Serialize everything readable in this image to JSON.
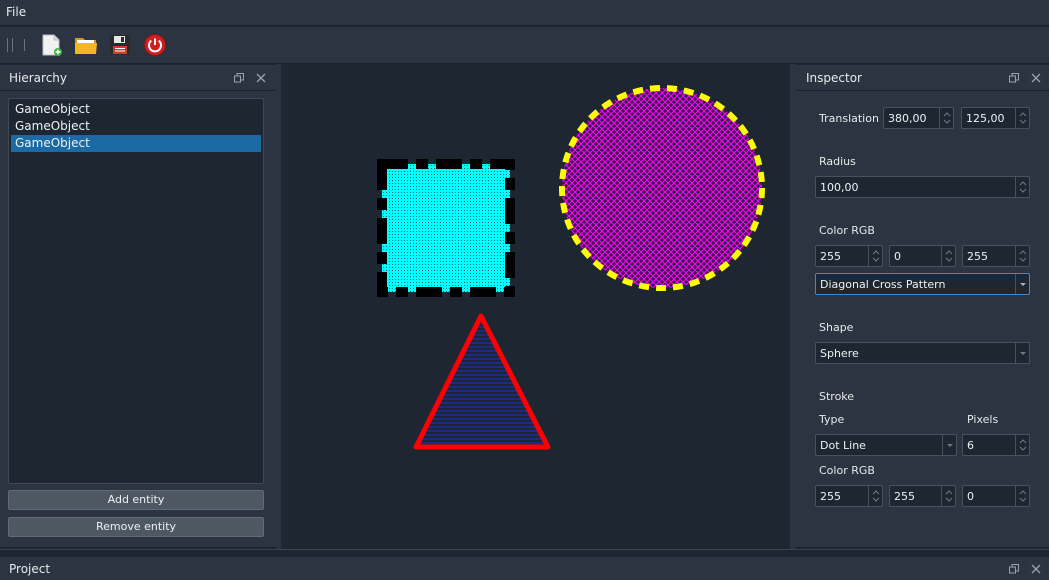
{
  "menubar": {
    "file": "File"
  },
  "toolbar": {
    "buttons": [
      {
        "name": "new-file-icon"
      },
      {
        "name": "open-folder-icon"
      },
      {
        "name": "save-icon"
      },
      {
        "name": "power-icon"
      }
    ]
  },
  "hierarchy": {
    "title": "Hierarchy",
    "items": [
      "GameObject",
      "GameObject",
      "GameObject"
    ],
    "selected_index": 2,
    "add_button": "Add entity",
    "remove_button": "Remove entity"
  },
  "inspector": {
    "title": "Inspector",
    "translation_label": "Translation",
    "translation_x": "380,00",
    "translation_y": "125,00",
    "radius_label": "Radius",
    "radius": "100,00",
    "color_label": "Color RGB",
    "color_r": "255",
    "color_g": "0",
    "color_b": "255",
    "fill_pattern": "Diagonal Cross Pattern",
    "shape_label": "Shape",
    "shape": "Sphere",
    "stroke_label": "Stroke",
    "stroke_type_label": "Type",
    "stroke_pixels_label": "Pixels",
    "stroke_type": "Dot Line",
    "stroke_pixels": "6",
    "stroke_color_label": "Color RGB",
    "stroke_r": "255",
    "stroke_g": "255",
    "stroke_b": "0"
  },
  "project": {
    "title": "Project"
  },
  "colors": {
    "background": "#1e2731",
    "panel": "#2b3440",
    "selection": "#1b6aa5",
    "square_fill": "#00ffff",
    "square_stroke": "#000000",
    "circle_fill": "#ff00ff",
    "circle_stroke": "#ffff00",
    "triangle_fill": "#1c2a8a",
    "triangle_stroke": "#ff0000"
  }
}
